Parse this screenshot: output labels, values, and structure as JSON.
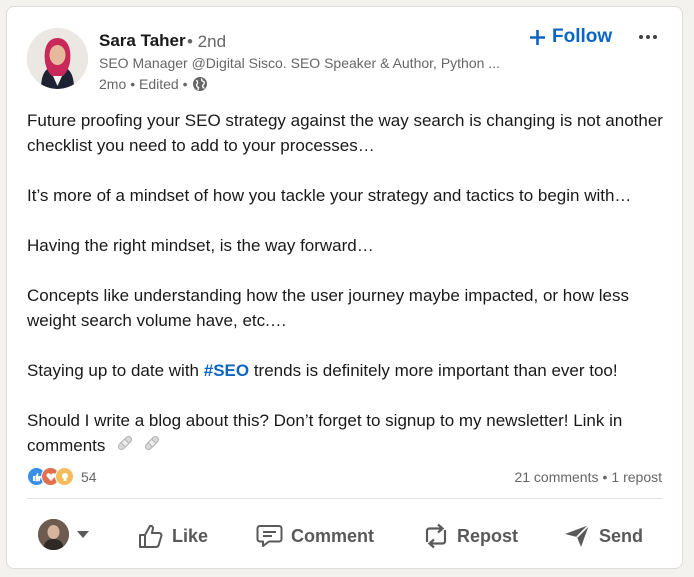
{
  "author": {
    "name": "Sara Taher",
    "degree": "• 2nd",
    "headline": "SEO Manager @Digital Sisco. SEO Speaker & Author, Python ...",
    "time": "2mo",
    "edited": "• Edited •",
    "visibility_icon": "globe-icon"
  },
  "follow_label": "Follow",
  "post": {
    "paragraph1": "Future proofing your SEO strategy against the way search is changing is not another checklist you need to add to your processes…",
    "paragraph2": "It’s more of a mindset of how you tackle your strategy and tactics to begin with…",
    "paragraph3": "Having the right mindset, is the way forward…",
    "paragraph4": "Concepts like understanding how the user journey maybe impacted, or how less weight search volume have, etc.…",
    "paragraph5_before": "Staying up to date with ",
    "paragraph5_hashtag": "#SEO",
    "paragraph5_after": " trends is definitely more important than ever too!",
    "paragraph6": "Should I write a blog about this? Don’t forget to signup to my newsletter! Link in comments"
  },
  "social": {
    "reaction_count": "54",
    "comments": "21 comments",
    "separator": "•",
    "reposts": "1 repost",
    "reaction_icons": [
      "like-icon",
      "love-icon",
      "insightful-icon"
    ]
  },
  "actions": {
    "like": "Like",
    "comment": "Comment",
    "repost": "Repost",
    "send": "Send"
  },
  "colors": {
    "accent": "#0a66c2",
    "muted": "#666666",
    "action_text": "#595959"
  }
}
